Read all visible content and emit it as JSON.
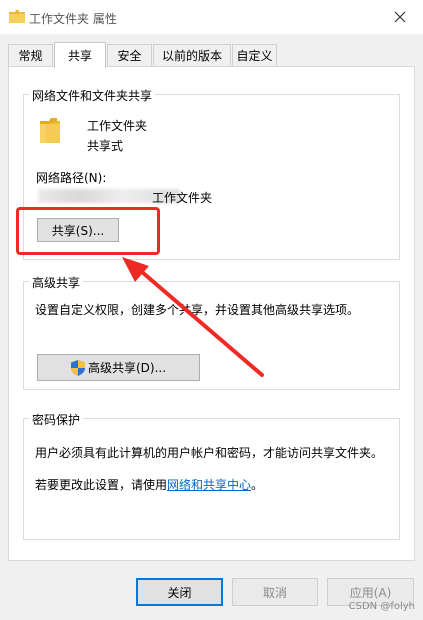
{
  "window": {
    "title": "工作文件夹 属性",
    "close_icon": "close-icon",
    "title_icon": "folder-icon"
  },
  "tabs": [
    {
      "label": "常规",
      "active": false
    },
    {
      "label": "共享",
      "active": true
    },
    {
      "label": "安全",
      "active": false
    },
    {
      "label": "以前的版本",
      "active": false
    },
    {
      "label": "自定义",
      "active": false
    }
  ],
  "network_sharing": {
    "group_label": "网络文件和文件夹共享",
    "folder_name": "工作文件夹",
    "share_state": "共享式",
    "path_label": "网络路径(N):",
    "path_value": "工作文件夹",
    "share_button": "共享(S)..."
  },
  "advanced_sharing": {
    "group_label": "高级共享",
    "description": "设置自定义权限，创建多个共享，并设置其他高级共享选项。",
    "button": "高级共享(D)...",
    "button_icon": "uac-shield-icon"
  },
  "password_protection": {
    "group_label": "密码保护",
    "description": "用户必须具有此计算机的用户帐户和密码，才能访问共享文件夹。",
    "change_prefix": "若要更改此设置，请使用",
    "link_text": "网络和共享中心",
    "change_suffix": "。"
  },
  "footer": {
    "close": "关闭",
    "cancel": "取消",
    "apply": "应用(A)"
  },
  "annotation": {
    "color": "#ee2a24"
  },
  "watermark": "CSDN @folyh"
}
